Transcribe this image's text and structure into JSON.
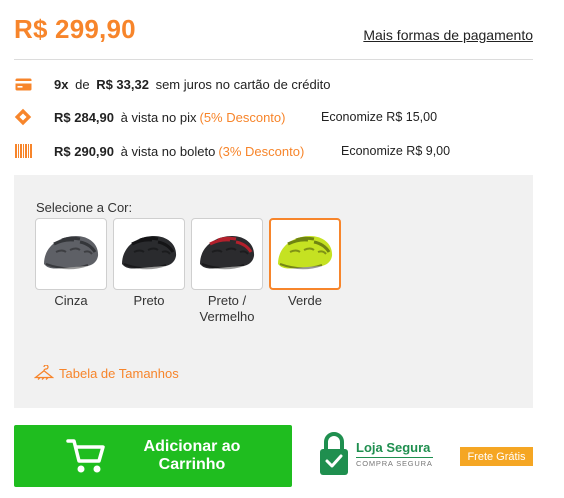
{
  "price": {
    "main": "R$ 299,90",
    "more_payment_link": "Mais formas de pagamento"
  },
  "payment_options": {
    "card": {
      "installments": "9x",
      "connector": "de",
      "amount": "R$ 33,32",
      "desc": "sem juros no cartão de crédito"
    },
    "pix": {
      "amount": "R$ 284,90",
      "desc": "à vista no pix",
      "discount": "(5% Desconto)",
      "savings": "Economize R$ 15,00"
    },
    "boleto": {
      "amount": "R$ 290,90",
      "desc": "à vista no boleto",
      "discount": "(3% Desconto)",
      "savings": "Economize R$ 9,00"
    }
  },
  "options": {
    "color_label": "Selecione a Cor:",
    "colors": [
      {
        "label": "Cinza",
        "helmet": "#5e6066",
        "stripe": "#34363a"
      },
      {
        "label": "Preto",
        "helmet": "#2a2b2e",
        "stripe": "#141416"
      },
      {
        "label": "Preto / Vermelho",
        "helmet": "#2b2b2e",
        "stripe": "#b3202c"
      },
      {
        "label": "Verde",
        "helmet": "#c5e222",
        "stripe": "#6f8411",
        "selected": true
      }
    ],
    "size_table_link": "Tabela de Tamanhos"
  },
  "actions": {
    "add_to_cart_line1": "Adicionar ao",
    "add_to_cart_line2": "Carrinho",
    "secure_title": "Loja Segura",
    "secure_subtitle": "COMPRA SEGURA",
    "free_shipping": "Frete Grátis"
  },
  "colors": {
    "accent": "#f7852b",
    "cart_green": "#1fbd1f",
    "seal_green": "#1f8f4f",
    "badge_orange": "#f5a623"
  }
}
